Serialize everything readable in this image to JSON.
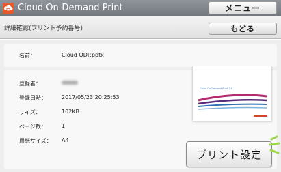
{
  "app": {
    "title": "Cloud On-Demand Print",
    "icon": "cloud-print-app-icon",
    "menu_label": "メニュー"
  },
  "subheader": {
    "title": "詳細確認(プリント予約番号)",
    "back_label": "もどる"
  },
  "details": {
    "name_label": "名前：",
    "name_value": "Cloud ODP.pptx",
    "registrant_label": "登録者：",
    "registrant_value": "",
    "registered_at_label": "登録日時：",
    "registered_at_value": "2017/05/23 20:25:53",
    "size_label": "サイズ：",
    "size_value": "102KB",
    "pages_label": "ページ数：",
    "pages_value": "1",
    "paper_size_label": "用紙サイズ：",
    "paper_size_value": "A4"
  },
  "preview": {
    "title_text": "Cloud On-Demand Print 2.0"
  },
  "actions": {
    "print_settings_label": "プリント設定"
  },
  "colors": {
    "titlebar": "#7d8389",
    "app_icon": "#e8582a",
    "highlight": "#9ed64c"
  }
}
